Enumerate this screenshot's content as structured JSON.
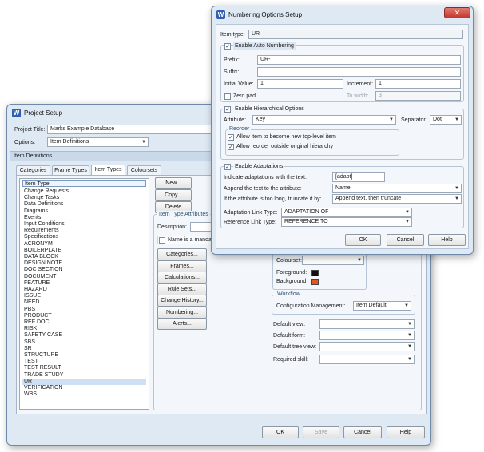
{
  "project_setup": {
    "title": "Project Setup",
    "project_title_label": "Project Title:",
    "project_title_value": "Marks Example Database",
    "options_label": "Options:",
    "options_value": "Item Definitions",
    "section_header": "Item Definitions",
    "tabs": [
      "Categories",
      "Frame Types",
      "Item Types",
      "Coloursets"
    ],
    "active_tab": "Item Types",
    "list_header": "Item Type",
    "item_types": [
      "Change Requests",
      "Change Tasks",
      "Data Definitions",
      "Diagrams",
      "Events",
      "Input Conditions",
      "Requirements",
      "Specifications",
      "ACRONYM",
      "BOILERPLATE",
      "DATA BLOCK",
      "DESIGN NOTE",
      "DOC SECTION",
      "DOCUMENT",
      "FEATURE",
      "HAZARD",
      "ISSUE",
      "NEED",
      "PBS",
      "PRODUCT",
      "REF DOC",
      "RISK",
      "SAFETY CASE",
      "SBS",
      "SR",
      "STRUCTURE",
      "TEST",
      "TEST RESULT",
      "TRADE STUDY",
      "UR",
      "VERIFICATION",
      "WBS"
    ],
    "selected_item": "UR",
    "side_buttons": {
      "new": "New...",
      "copy": "Copy...",
      "delete": "Delete"
    },
    "attributes_group": "Item Type Attributes",
    "description_label": "Description:",
    "name_mandatory_label": "Name is a mandat",
    "attr_buttons": [
      "Categories...",
      "Frames...",
      "Calculations...",
      "Rule Sets...",
      "Change History...",
      "Numbering...",
      "Alerts..."
    ],
    "colourset_label": "Colourset:",
    "foreground_label": "Foreground:",
    "foreground_color": "#111111",
    "background_label": "Background:",
    "background_color": "#e8541e",
    "workflow_group": "Workflow",
    "config_mgmt_label": "Configuration Management:",
    "config_mgmt_value": "Item Default",
    "default_view_label": "Default view:",
    "default_form_label": "Default form:",
    "default_tree_view_label": "Default tree view:",
    "required_skill_label": "Required skill:",
    "bottom_buttons": {
      "ok": "OK",
      "save": "Save",
      "cancel": "Cancel",
      "help": "Help"
    }
  },
  "numbering": {
    "title": "Numbering Options Setup",
    "item_type_label": "Item type:",
    "item_type_value": "UR",
    "enable_auto": "Enable Auto Numbering",
    "prefix_label": "Prefix:",
    "prefix_value": "UR-",
    "suffix_label": "Suffix:",
    "suffix_value": "",
    "initial_label": "Initial Value:",
    "initial_value": "1",
    "increment_label": "Increment:",
    "increment_value": "1",
    "zero_pad_label": "Zero pad",
    "to_width_label": "To width:",
    "to_width_value": "3",
    "enable_hier": "Enable Hierarchical Options",
    "attribute_label": "Attribute:",
    "attribute_value": "Key",
    "separator_label": "Separator:",
    "separator_value": "Dot",
    "reorder_group": "Reorder",
    "allow_top_level": "Allow item to become new top-level item",
    "allow_reorder": "Allow reorder outside original hierarchy",
    "enable_adapt": "Enable Adaptations",
    "indicate_label": "Indicate adaptations with the text:",
    "indicate_value": "[adapt]",
    "append_label": "Append the text to the attribute:",
    "append_value": "Name",
    "truncate_label": "If the attribute is too long, truncate it by:",
    "truncate_value": "Append text, then truncate",
    "adapt_link_label": "Adaptation Link Type:",
    "adapt_link_value": "ADAPTATION OF",
    "ref_link_label": "Reference Link Type:",
    "ref_link_value": "REFERENCE TO",
    "buttons": {
      "ok": "OK",
      "cancel": "Cancel",
      "help": "Help"
    }
  },
  "icons": {
    "app": "app-logo-icon",
    "close": "close-icon",
    "dropdown": "chevron-down-icon"
  },
  "colors": {
    "accent": "#2f5fb0",
    "window_bg": "#dfe9f4",
    "close_button": "#c9463d"
  }
}
